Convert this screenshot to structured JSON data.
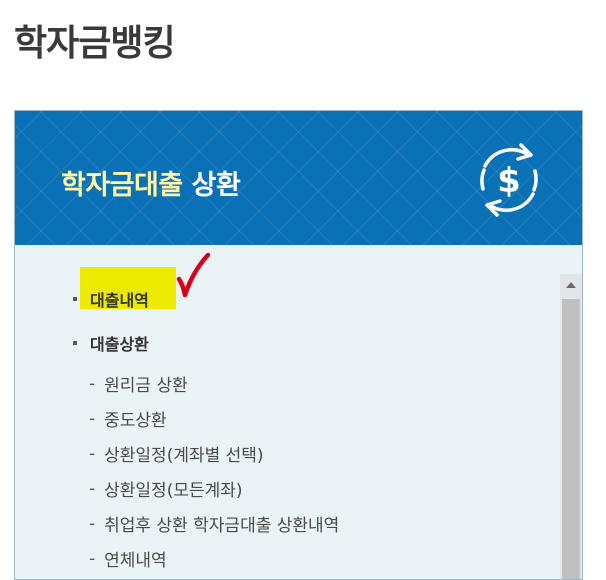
{
  "page": {
    "title": "학자금뱅킹"
  },
  "banner": {
    "title_part1": "학자금대출",
    "title_part2": "상환",
    "icon": "dollar-cycle-icon"
  },
  "menu": {
    "items": [
      {
        "label": "대출내역",
        "highlighted": true,
        "annotation": "red-check-icon"
      },
      {
        "label": "대출상환"
      }
    ],
    "sub_items": [
      "원리금 상환",
      "중도상환",
      "상환일정(계좌별 선택)",
      "상환일정(모든계좌)",
      "취업후 상환 학자금대출 상환내역",
      "연체내역"
    ],
    "sub_marker": "-"
  },
  "colors": {
    "banner": "#0a71b7",
    "banner_highlight_text": "#fff6a6",
    "panel_bg": "#eaf4f7",
    "highlight": "#ecea00",
    "check": "#d9001b"
  }
}
